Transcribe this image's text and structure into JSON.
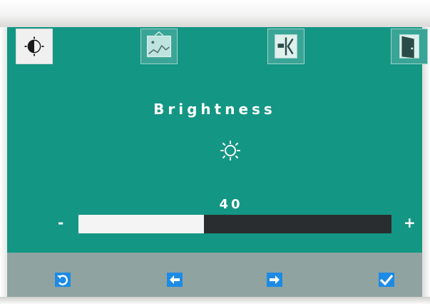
{
  "menu": {
    "title": "Brightness",
    "tabs": [
      {
        "icon": "brightness-icon",
        "active": true
      },
      {
        "icon": "image-icon",
        "active": false
      },
      {
        "icon": "input-select-icon",
        "active": false
      },
      {
        "icon": "exit-icon",
        "active": false
      }
    ]
  },
  "slider": {
    "value_text": "40",
    "value": 40,
    "min_symbol": "-",
    "max_symbol": "+"
  },
  "buttons": [
    {
      "icon": "reset-icon"
    },
    {
      "icon": "left-arrow-icon"
    },
    {
      "icon": "right-arrow-icon"
    },
    {
      "icon": "checkmark-icon"
    }
  ],
  "colors": {
    "panel": "#149684",
    "button": "#1d8be5",
    "bar": "#8fa3a1"
  }
}
